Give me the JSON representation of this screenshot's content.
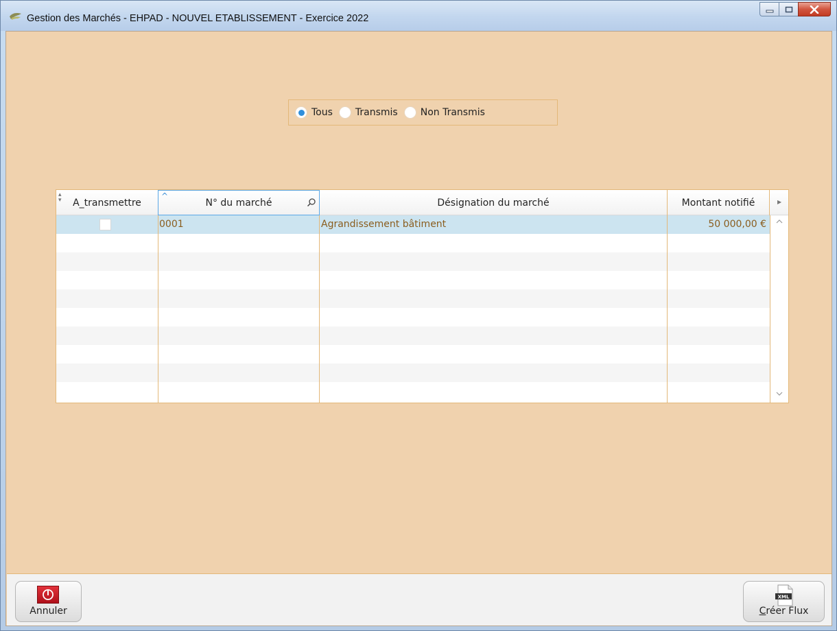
{
  "window": {
    "title": "Gestion des Marchés  -  EHPAD  -  NOUVEL ETABLISSEMENT  -  Exercice  2022",
    "controls": {
      "minimize": "minimize-icon",
      "maximize": "maximize-icon",
      "close": "close-icon"
    }
  },
  "filter": {
    "options": [
      {
        "label": "Tous",
        "selected": true
      },
      {
        "label": "Transmis",
        "selected": false
      },
      {
        "label": "Non Transmis",
        "selected": false
      }
    ]
  },
  "grid": {
    "columns": [
      {
        "label": "A_transmettre"
      },
      {
        "label": "N° du marché"
      },
      {
        "label": "Désignation du  marché"
      },
      {
        "label": "Montant notifié"
      }
    ],
    "rows": [
      {
        "a_transmettre": false,
        "numero": "0001",
        "designation": "Agrandissement bâtiment",
        "montant": "50 000,00 €"
      }
    ],
    "empty_rows": 9
  },
  "footer": {
    "cancel": {
      "label_pre": "",
      "label_ul": "",
      "label": "Annuler",
      "icon": "power-icon"
    },
    "create": {
      "label_ul": "C",
      "label_rest": "réer Flux",
      "icon": "xml-file-icon",
      "icon_text": "XML"
    }
  },
  "colors": {
    "client_bg": "#f0d2ae",
    "border_accent": "#e3b879",
    "selected_row": "#cce4f0",
    "cell_text": "#8a5d1e",
    "radio_on": "#2f8fdc"
  }
}
